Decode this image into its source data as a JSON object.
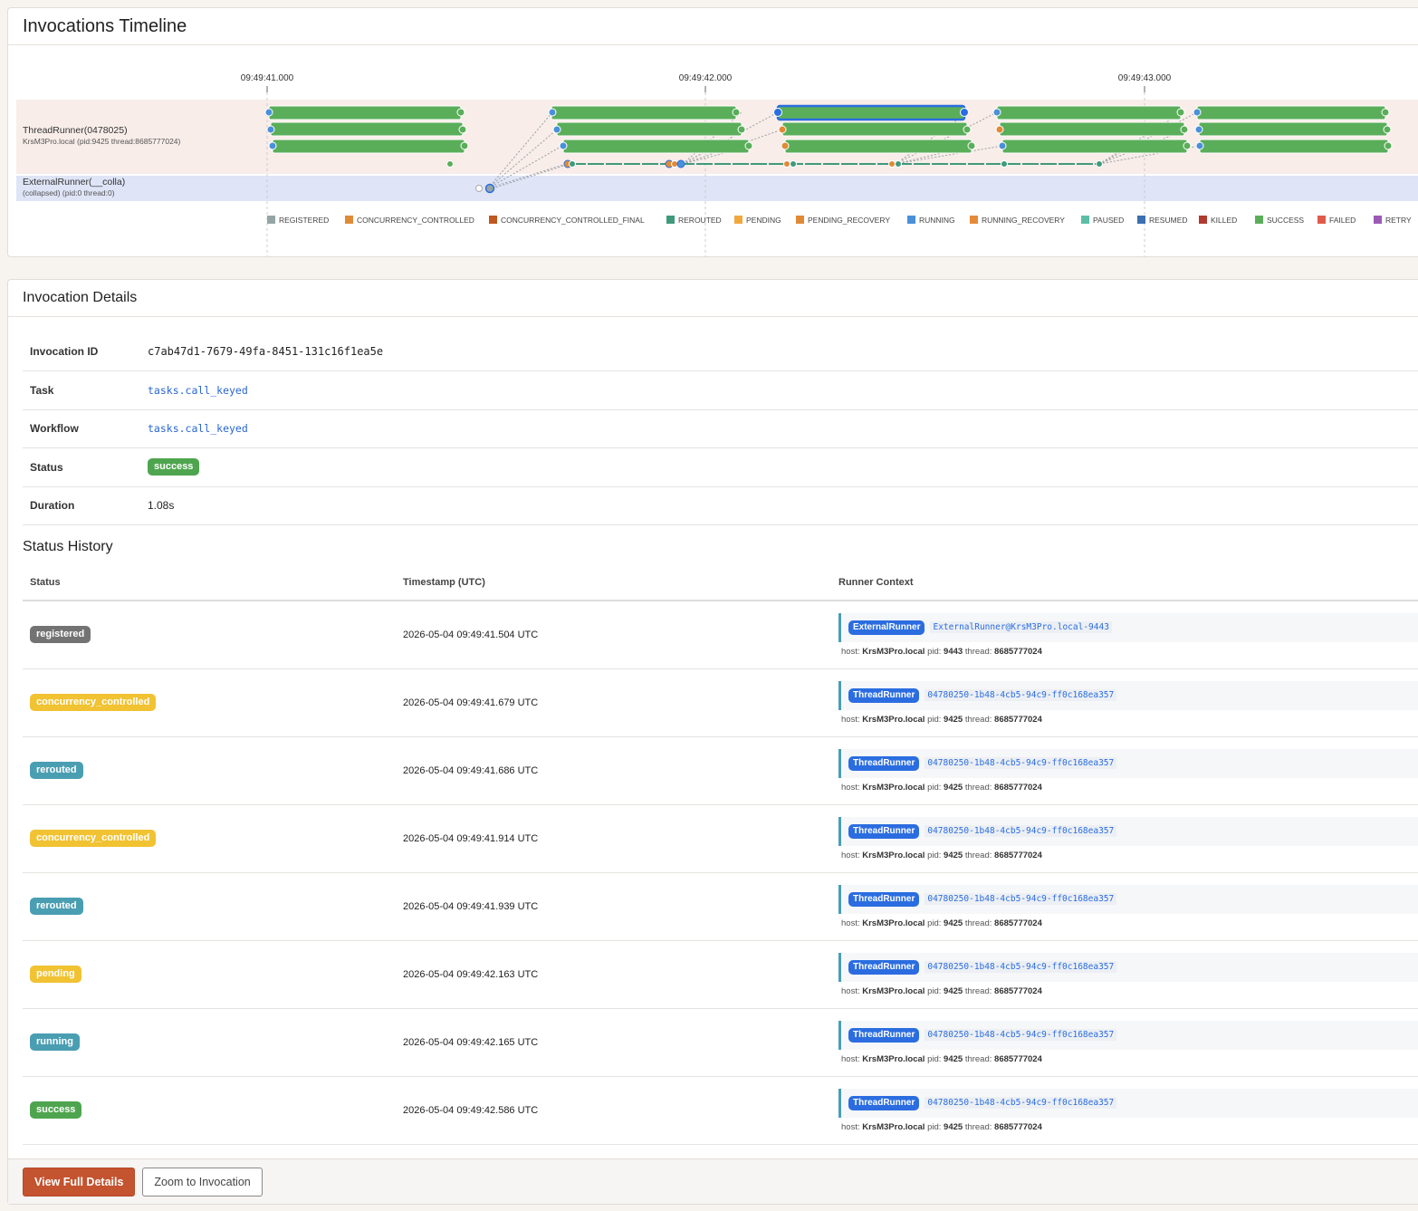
{
  "timeline": {
    "title": "Invocations Timeline",
    "axis_ticks": [
      "09:49:41.000",
      "09:49:42.000",
      "09:49:43.000"
    ],
    "lanes": [
      {
        "name": "ThreadRunner(0478025)",
        "subtitle": "KrsM3Pro.local (pid:9425 thread:8685777024)"
      },
      {
        "name": "ExternalRunner(__colla)",
        "subtitle": "(collapsed) (pid:0 thread:0)"
      }
    ],
    "legend": [
      {
        "label": "REGISTERED",
        "color": "#95a5a6"
      },
      {
        "label": "CONCURRENCY_CONTROLLED",
        "color": "#e08a36"
      },
      {
        "label": "CONCURRENCY_CONTROLLED_FINAL",
        "color": "#c0571c"
      },
      {
        "label": "REROUTED",
        "color": "#3f9a7c"
      },
      {
        "label": "PENDING",
        "color": "#f0a83a"
      },
      {
        "label": "PENDING_RECOVERY",
        "color": "#e08a36"
      },
      {
        "label": "RUNNING",
        "color": "#4a90d9"
      },
      {
        "label": "RUNNING_RECOVERY",
        "color": "#e68a3a"
      },
      {
        "label": "PAUSED",
        "color": "#5bbfa6"
      },
      {
        "label": "RESUMED",
        "color": "#3c6fb0"
      },
      {
        "label": "KILLED",
        "color": "#b03a2e"
      },
      {
        "label": "SUCCESS",
        "color": "#5aae5a"
      },
      {
        "label": "FAILED",
        "color": "#e05a4a"
      },
      {
        "label": "RETRY",
        "color": "#9b59b6"
      }
    ]
  },
  "details": {
    "title": "Invocation Details",
    "rows": [
      {
        "key": "Invocation ID",
        "value": "c7ab47d1-7679-49fa-8451-131c16f1ea5e"
      },
      {
        "key": "Task",
        "value": "tasks.call_keyed"
      },
      {
        "key": "Workflow",
        "value": "tasks.call_keyed"
      },
      {
        "key": "Status",
        "value": "success"
      },
      {
        "key": "Duration",
        "value": "1.08s"
      }
    ]
  },
  "history": {
    "title": "Status History",
    "headers": [
      "Status",
      "Timestamp (UTC)",
      "Runner Context"
    ],
    "host_label": "host:",
    "pid_label": "pid:",
    "thread_label": "thread:",
    "rows": [
      {
        "status": "registered",
        "ts": "2026-05-04 09:49:41.504 UTC",
        "runner": "ExternalRunner",
        "rid": "ExternalRunner@KrsM3Pro.local-9443",
        "host": "KrsM3Pro.local",
        "pid": "9443",
        "thread": "8685777024"
      },
      {
        "status": "concurrency_controlled",
        "ts": "2026-05-04 09:49:41.679 UTC",
        "runner": "ThreadRunner",
        "rid": "04780250-1b48-4cb5-94c9-ff0c168ea357",
        "host": "KrsM3Pro.local",
        "pid": "9425",
        "thread": "8685777024"
      },
      {
        "status": "rerouted",
        "ts": "2026-05-04 09:49:41.686 UTC",
        "runner": "ThreadRunner",
        "rid": "04780250-1b48-4cb5-94c9-ff0c168ea357",
        "host": "KrsM3Pro.local",
        "pid": "9425",
        "thread": "8685777024"
      },
      {
        "status": "concurrency_controlled",
        "ts": "2026-05-04 09:49:41.914 UTC",
        "runner": "ThreadRunner",
        "rid": "04780250-1b48-4cb5-94c9-ff0c168ea357",
        "host": "KrsM3Pro.local",
        "pid": "9425",
        "thread": "8685777024"
      },
      {
        "status": "rerouted",
        "ts": "2026-05-04 09:49:41.939 UTC",
        "runner": "ThreadRunner",
        "rid": "04780250-1b48-4cb5-94c9-ff0c168ea357",
        "host": "KrsM3Pro.local",
        "pid": "9425",
        "thread": "8685777024"
      },
      {
        "status": "pending",
        "ts": "2026-05-04 09:49:42.163 UTC",
        "runner": "ThreadRunner",
        "rid": "04780250-1b48-4cb5-94c9-ff0c168ea357",
        "host": "KrsM3Pro.local",
        "pid": "9425",
        "thread": "8685777024"
      },
      {
        "status": "running",
        "ts": "2026-05-04 09:49:42.165 UTC",
        "runner": "ThreadRunner",
        "rid": "04780250-1b48-4cb5-94c9-ff0c168ea357",
        "host": "KrsM3Pro.local",
        "pid": "9425",
        "thread": "8685777024"
      },
      {
        "status": "success",
        "ts": "2026-05-04 09:49:42.586 UTC",
        "runner": "ThreadRunner",
        "rid": "04780250-1b48-4cb5-94c9-ff0c168ea357",
        "host": "KrsM3Pro.local",
        "pid": "9425",
        "thread": "8685777024"
      }
    ]
  },
  "footer": {
    "view_label": "View Full Details",
    "zoom_label": "Zoom to Invocation"
  }
}
